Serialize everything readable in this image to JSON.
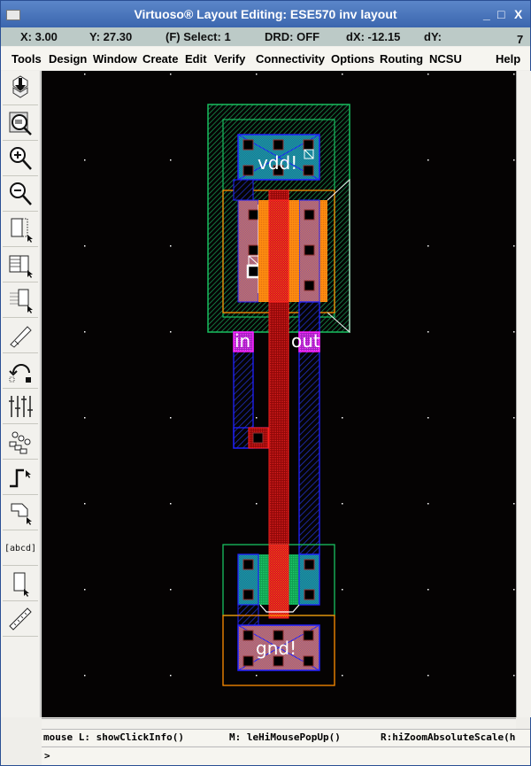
{
  "window": {
    "title": "Virtuoso® Layout Editing: ESE570 inv layout",
    "minimize": "_",
    "maximize": "□",
    "close": "X"
  },
  "status": {
    "x": "X:  3.00",
    "y": "Y:  27.30",
    "select": "(F) Select: 1",
    "drd": "DRD: OFF",
    "dx": "dX: -12.15",
    "dy": "dY:",
    "dy_value": "7"
  },
  "menu": [
    "Tools",
    "Design",
    "Window",
    "Create",
    "Edit",
    "Verify",
    "Connectivity",
    "Options",
    "Routing",
    "NCSU",
    "Help"
  ],
  "toolbar": [
    {
      "name": "save-icon"
    },
    {
      "name": "zoom-fit-icon"
    },
    {
      "name": "zoom-in-icon"
    },
    {
      "name": "zoom-out-icon"
    },
    {
      "name": "stretch-icon"
    },
    {
      "name": "copy-icon"
    },
    {
      "name": "move-icon"
    },
    {
      "name": "delete-icon"
    },
    {
      "name": "undo-icon"
    },
    {
      "name": "properties-icon"
    },
    {
      "name": "instance-icon"
    },
    {
      "name": "path-icon"
    },
    {
      "name": "polygon-icon"
    },
    {
      "name": "label-icon",
      "text": "[abcd]"
    },
    {
      "name": "rectangle-icon"
    },
    {
      "name": "ruler-icon"
    }
  ],
  "layout": {
    "labels": {
      "vdd": "vdd!",
      "in": "in",
      "out": "out",
      "gnd": "gnd!"
    },
    "colors": {
      "nwell": "#18c060",
      "pselect": "#ff8c00",
      "nselect": "#18c060",
      "active_p": "#ff8c00",
      "metal1": "#2020ff",
      "metal1_fill": "#1a6fa0",
      "poly": "#ff2020",
      "pin": "#ff20ff",
      "contact": "#000000",
      "contact_edge": "#a03030",
      "grid": "#ffffff",
      "background": "#050303"
    }
  },
  "messages": {
    "mouse_l": "mouse L: showClickInfo()",
    "mouse_m": "M: leHiMousePopUp()",
    "mouse_r": "R:hiZoomAbsoluteScale(h"
  },
  "command": {
    "prompt": ">"
  }
}
